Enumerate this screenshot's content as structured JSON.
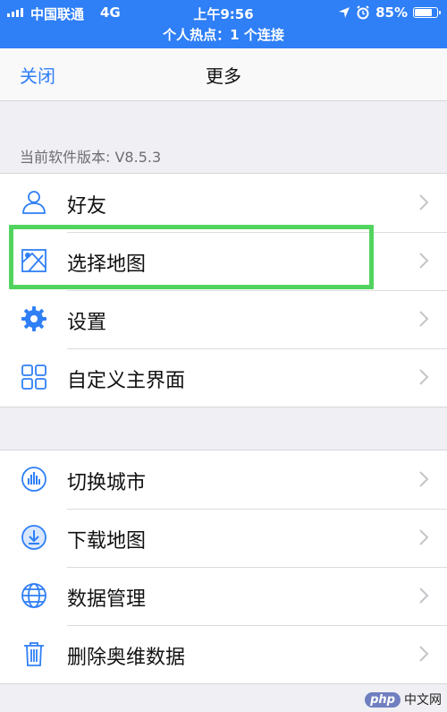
{
  "status_bar": {
    "carrier": "中国联通",
    "network": "4G",
    "time": "上午9:56",
    "battery": "85%",
    "battery_level": 0.85,
    "hotspot": "个人热点：1 个连接"
  },
  "nav": {
    "close_label": "关闭",
    "title": "更多"
  },
  "version_text": "当前软件版本: V8.5.3",
  "group1": [
    {
      "label": "好友",
      "icon": "user-icon"
    },
    {
      "label": "选择地图",
      "icon": "map-icon"
    },
    {
      "label": "设置",
      "icon": "gear-icon"
    },
    {
      "label": "自定义主界面",
      "icon": "grid-icon"
    }
  ],
  "group2": [
    {
      "label": "切换城市",
      "icon": "city-icon"
    },
    {
      "label": "下载地图",
      "icon": "download-icon"
    },
    {
      "label": "数据管理",
      "icon": "globe-icon"
    },
    {
      "label": "删除奥维数据",
      "icon": "trash-icon"
    }
  ],
  "watermark": {
    "logo": "php",
    "text": "中文网"
  },
  "colors": {
    "accent": "#2f7ff6",
    "highlight": "#52d35f",
    "background": "#efeff4"
  }
}
